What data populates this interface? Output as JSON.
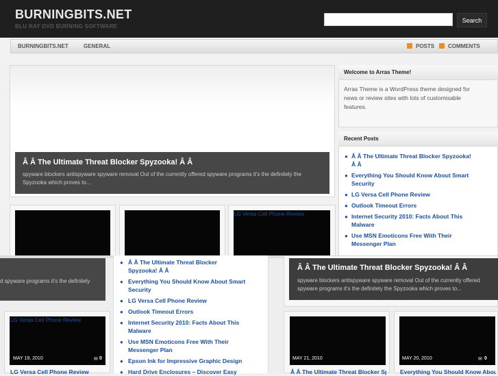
{
  "site": {
    "title": "BURNINGBITS.NET",
    "tagline": "BLU RAY DVD BURNING SOFTWARE"
  },
  "search": {
    "placeholder": "",
    "button": "Search"
  },
  "nav": {
    "items": [
      "BURNINGBITS.NET",
      "GENERAL"
    ],
    "feeds": [
      "POSTS",
      "COMMENTS"
    ]
  },
  "featured": {
    "title": "Â  Â The Ultimate Threat Blocker Spyzooka! Â  Â",
    "excerpt": "spyware blockers antispyware spyware removal Out of the currently offered spyware programs it's the definitely the Spyzooka which proves to...",
    "excerpt_partial": "d spyware programs it's the definitely"
  },
  "sidebar": {
    "welcome_title": "Welcome to Arras Theme!",
    "welcome_text": "Arras Theme is a WordPress theme designed for news or review sites with lots of customisable features.",
    "recent_title": "Recent Posts",
    "recent_posts": [
      "Â  Â The Ultimate Threat Blocker Spyzooka! Â  Â",
      "Everything You Should Know About Smart Security",
      "LG Versa Cell Phone Review",
      "Outlook Timeout Errors",
      "Internet Security 2010: Facts About This Malware",
      "Use MSN Emoticons Free With Their Messenger Plan"
    ],
    "recent_posts_overlay": [
      "Â  Â The Ultimate Threat Blocker Spyzooka! Â  Â",
      "Everything You Should Know About Smart Security",
      "LG Versa Cell Phone Review",
      "Outlook Timeout Errors",
      "Internet Security 2010: Facts About This Malware",
      "Use MSN Emoticons Free With Their Messenger Plan",
      "Epson Ink for Impressive Graphic Design",
      "Hard Drive Enclosures – Discover Easy"
    ]
  },
  "tiles": {
    "lg_label": "LG Versa Cell Phone Review",
    "date_may19": "MAY 19, 2010",
    "date_may20": "MAY 20, 2010",
    "date_may21": "MAY 21, 2010",
    "comments": "0",
    "partial_lg": "LG Versa Cell Phone Review",
    "partial_ultimate": "Â  Â The Ultimate Threat Blocker Spyzooka! Â  Â",
    "partial_everything": "Everything You Should Know About Smart Security"
  }
}
